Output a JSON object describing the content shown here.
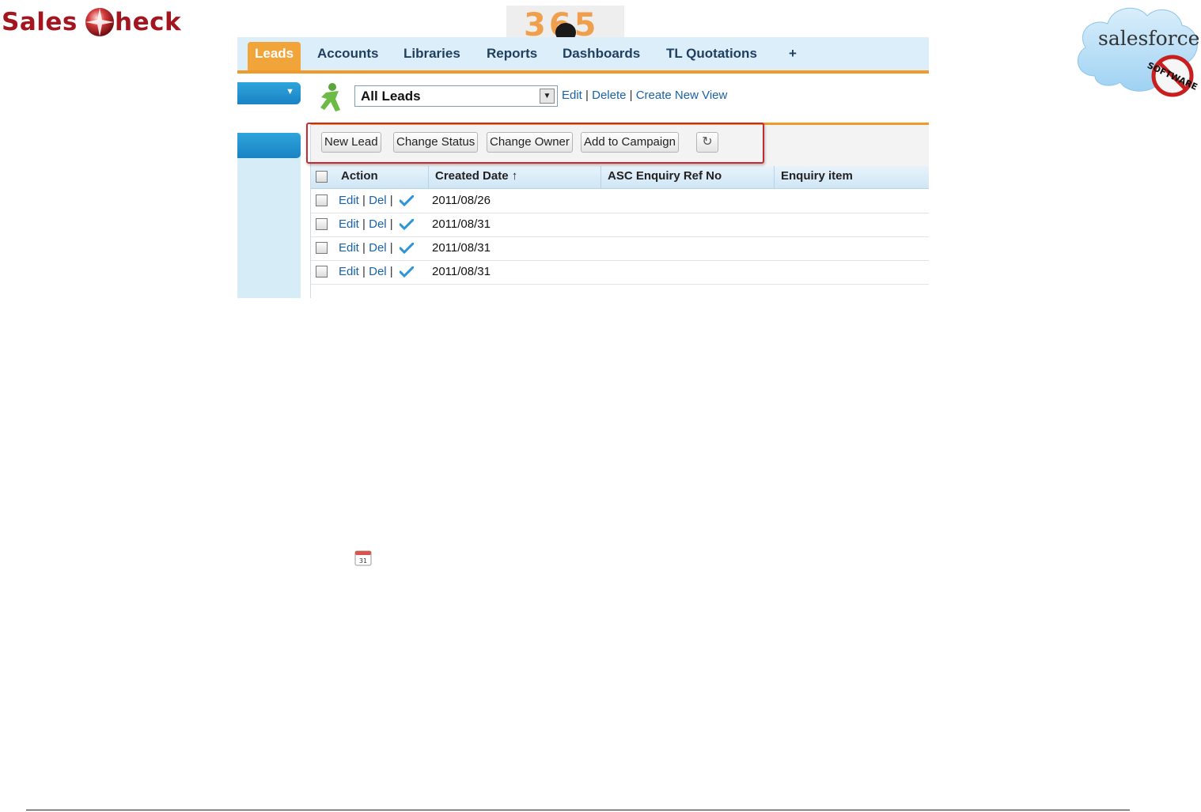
{
  "logos": {
    "salescheck": {
      "part1": "Sales",
      "part2": "heck"
    },
    "brand365": {
      "digits": "365"
    },
    "salesforce": {
      "text": "salesforce",
      "badge": "SOFTWARE"
    }
  },
  "tabs": [
    {
      "label": "Leads",
      "active": true
    },
    {
      "label": "Accounts"
    },
    {
      "label": "Libraries"
    },
    {
      "label": "Reports"
    },
    {
      "label": "Dashboards"
    },
    {
      "label": "TL Quotations"
    },
    {
      "label": "+"
    }
  ],
  "view": {
    "selected": "All Leads",
    "links": [
      "Edit",
      "Delete",
      "Create New View"
    ],
    "separator": "|"
  },
  "toolbar": {
    "buttons": [
      "New Lead",
      "Change Status",
      "Change Owner",
      "Add to Campaign"
    ],
    "refresh_symbol": "↻"
  },
  "table": {
    "columns": [
      "Action",
      "Created Date ↑",
      "ASC Enquiry Ref No",
      "Enquiry item"
    ],
    "action_edit": "Edit",
    "action_del": "Del",
    "separator": "|",
    "rows": [
      {
        "created_date": "2011/08/26"
      },
      {
        "created_date": "2011/08/31"
      },
      {
        "created_date": "2011/08/31"
      },
      {
        "created_date": "2011/08/31"
      }
    ]
  },
  "calendar_icon_day": "31",
  "colors": {
    "tab_active": "#f0a43a",
    "tab_bar": "#dbeef9",
    "accent_orange": "#ee9b2b",
    "link_blue": "#1a62a8",
    "highlight_red": "#c62a30",
    "salescheck_red": "#a3161f",
    "sidebar_blue": "#1a83c4"
  }
}
